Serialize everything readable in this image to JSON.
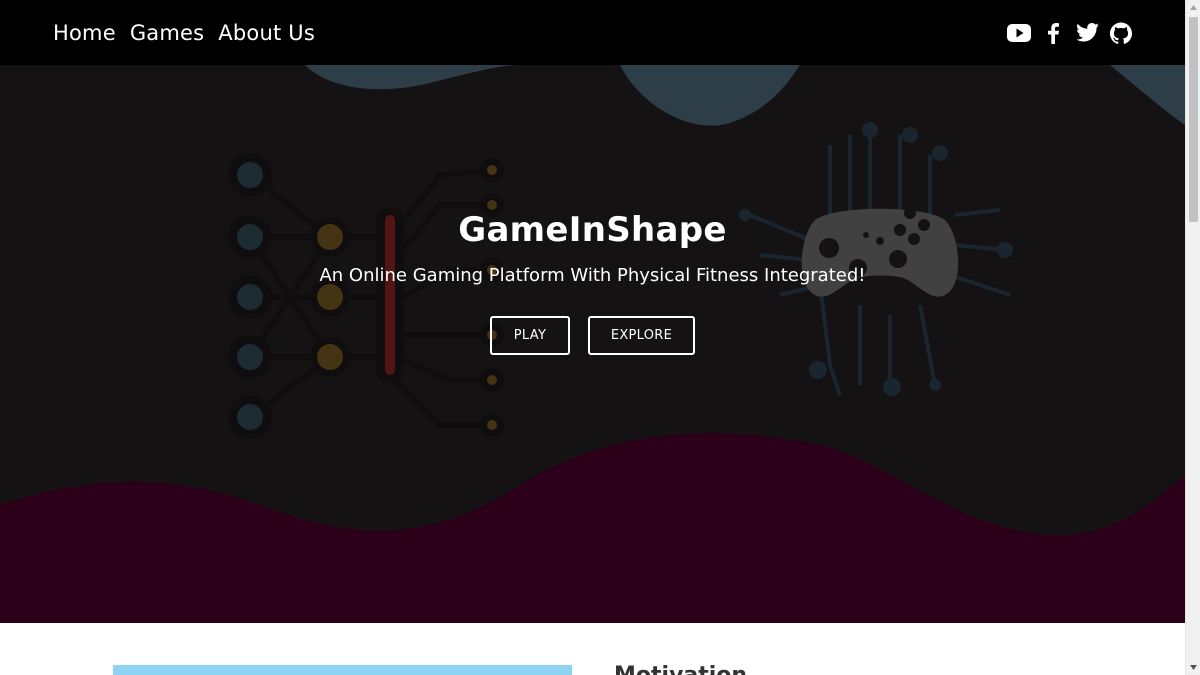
{
  "nav": {
    "links": [
      {
        "label": "Home"
      },
      {
        "label": "Games"
      },
      {
        "label": "About Us"
      }
    ],
    "social_icons": [
      "youtube-icon",
      "facebook-icon",
      "twitter-icon",
      "github-icon"
    ]
  },
  "hero": {
    "title": "GameInShape",
    "subtitle": "An Online Gaming Platform With Physical Fitness Integrated!",
    "play_label": "PLAY",
    "explore_label": "EXPLORE"
  },
  "section": {
    "heading": "Motivation"
  },
  "colors": {
    "navbar": "#000000",
    "hero_bg": "#141213",
    "wave_top": "#2d3e49",
    "wave_bottom": "#2c0019",
    "accent_image": "#8fd3f4"
  }
}
